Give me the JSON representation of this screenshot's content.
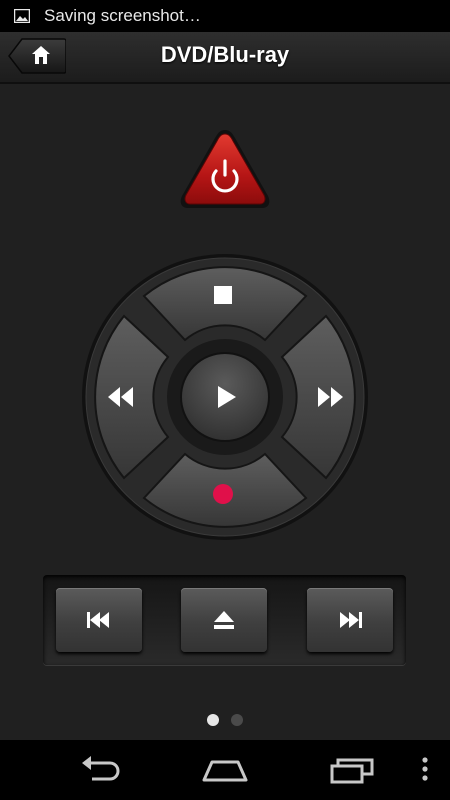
{
  "status_bar": {
    "icon": "image-icon",
    "text": "Saving screenshot…"
  },
  "header": {
    "title": "DVD/Blu-ray",
    "home_icon": "home-icon"
  },
  "remote": {
    "power_icon": "power-icon",
    "dpad": {
      "up": "stop-icon",
      "left": "rewind-icon",
      "center": "play-icon",
      "right": "fast-forward-icon",
      "down": "record-icon"
    },
    "transport": [
      "skip-previous-icon",
      "eject-icon",
      "skip-next-icon"
    ]
  },
  "pager": {
    "pages": 2,
    "active": 1
  },
  "navigation_bar": [
    "back-icon",
    "home-icon",
    "recent-apps-icon",
    "overflow-menu-icon"
  ],
  "colors": {
    "power_red": "#c62020",
    "record_red": "#e0104a",
    "button_grey": "#4a4a4a"
  }
}
